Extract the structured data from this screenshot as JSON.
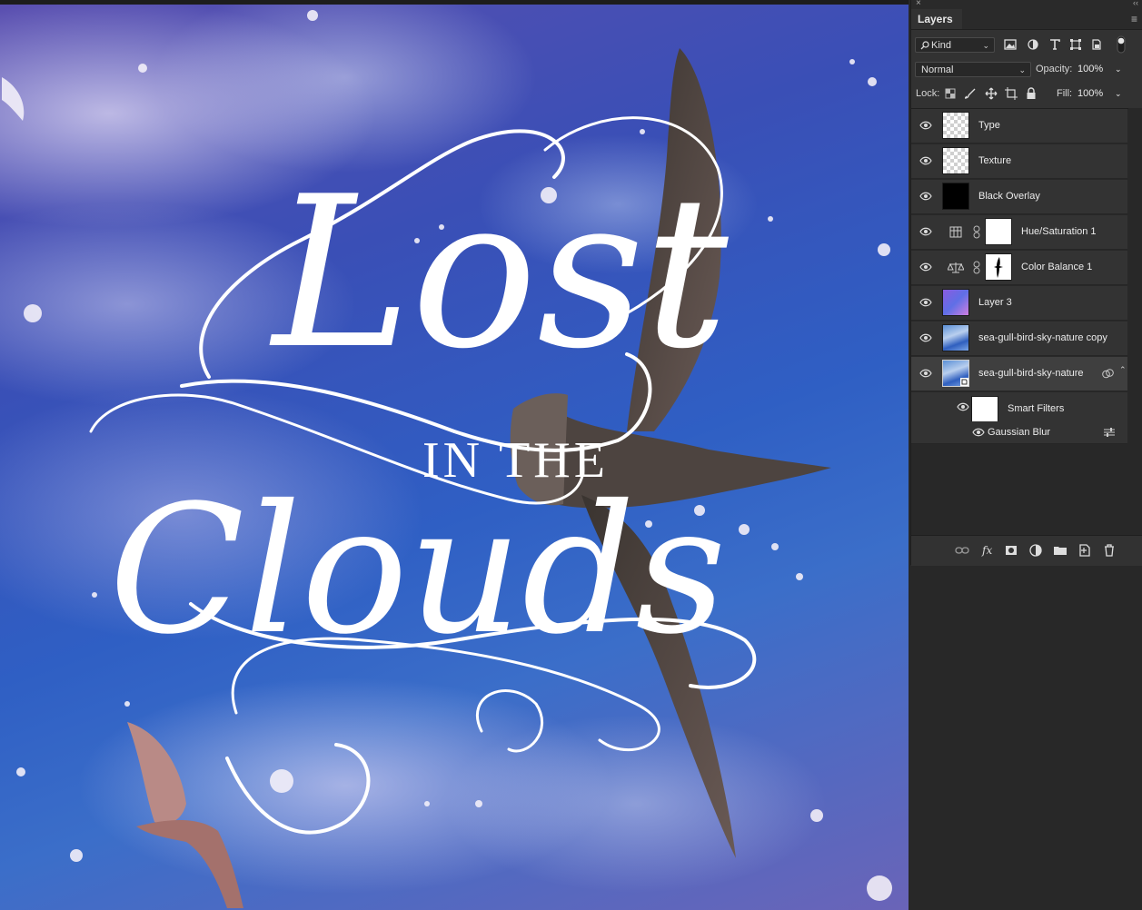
{
  "artwork": {
    "line1": "Lost",
    "line2": "IN THE",
    "line3": "Clouds"
  },
  "panel": {
    "tab": "Layers",
    "close_glyph": "×",
    "collapse_glyph": "‹‹",
    "menu_glyph": "≡",
    "filter": {
      "kind_label": "Kind"
    },
    "blend_mode": "Normal",
    "opacity_label": "Opacity:",
    "opacity_value": "100%",
    "lock_label": "Lock:",
    "fill_label": "Fill:",
    "fill_value": "100%"
  },
  "layers": [
    {
      "name": "Type",
      "thumb": "transparent",
      "visible": true
    },
    {
      "name": "Texture",
      "thumb": "transparent",
      "visible": true
    },
    {
      "name": "Black Overlay",
      "thumb": "black",
      "visible": true
    },
    {
      "name": "Hue/Saturation 1",
      "type": "adjustment",
      "icon": "hue-saturation-icon",
      "visible": true
    },
    {
      "name": "Color Balance 1",
      "type": "adjustment",
      "icon": "color-balance-icon",
      "visible": true
    },
    {
      "name": "Layer 3",
      "thumb": "gradient",
      "visible": true
    },
    {
      "name": "sea-gull-bird-sky-nature copy",
      "thumb": "photo",
      "visible": true
    },
    {
      "name": "sea-gull-bird-sky-nature",
      "thumb": "photo",
      "visible": true,
      "selected": true,
      "smart_object": true
    }
  ],
  "smart_filters": {
    "label": "Smart Filters",
    "filters": [
      {
        "name": "Gaussian Blur"
      }
    ]
  },
  "colors": {
    "panel_bg": "#323232",
    "layer_bg": "#333333",
    "selected_bg": "#3f3f3f",
    "text": "#ececec"
  }
}
